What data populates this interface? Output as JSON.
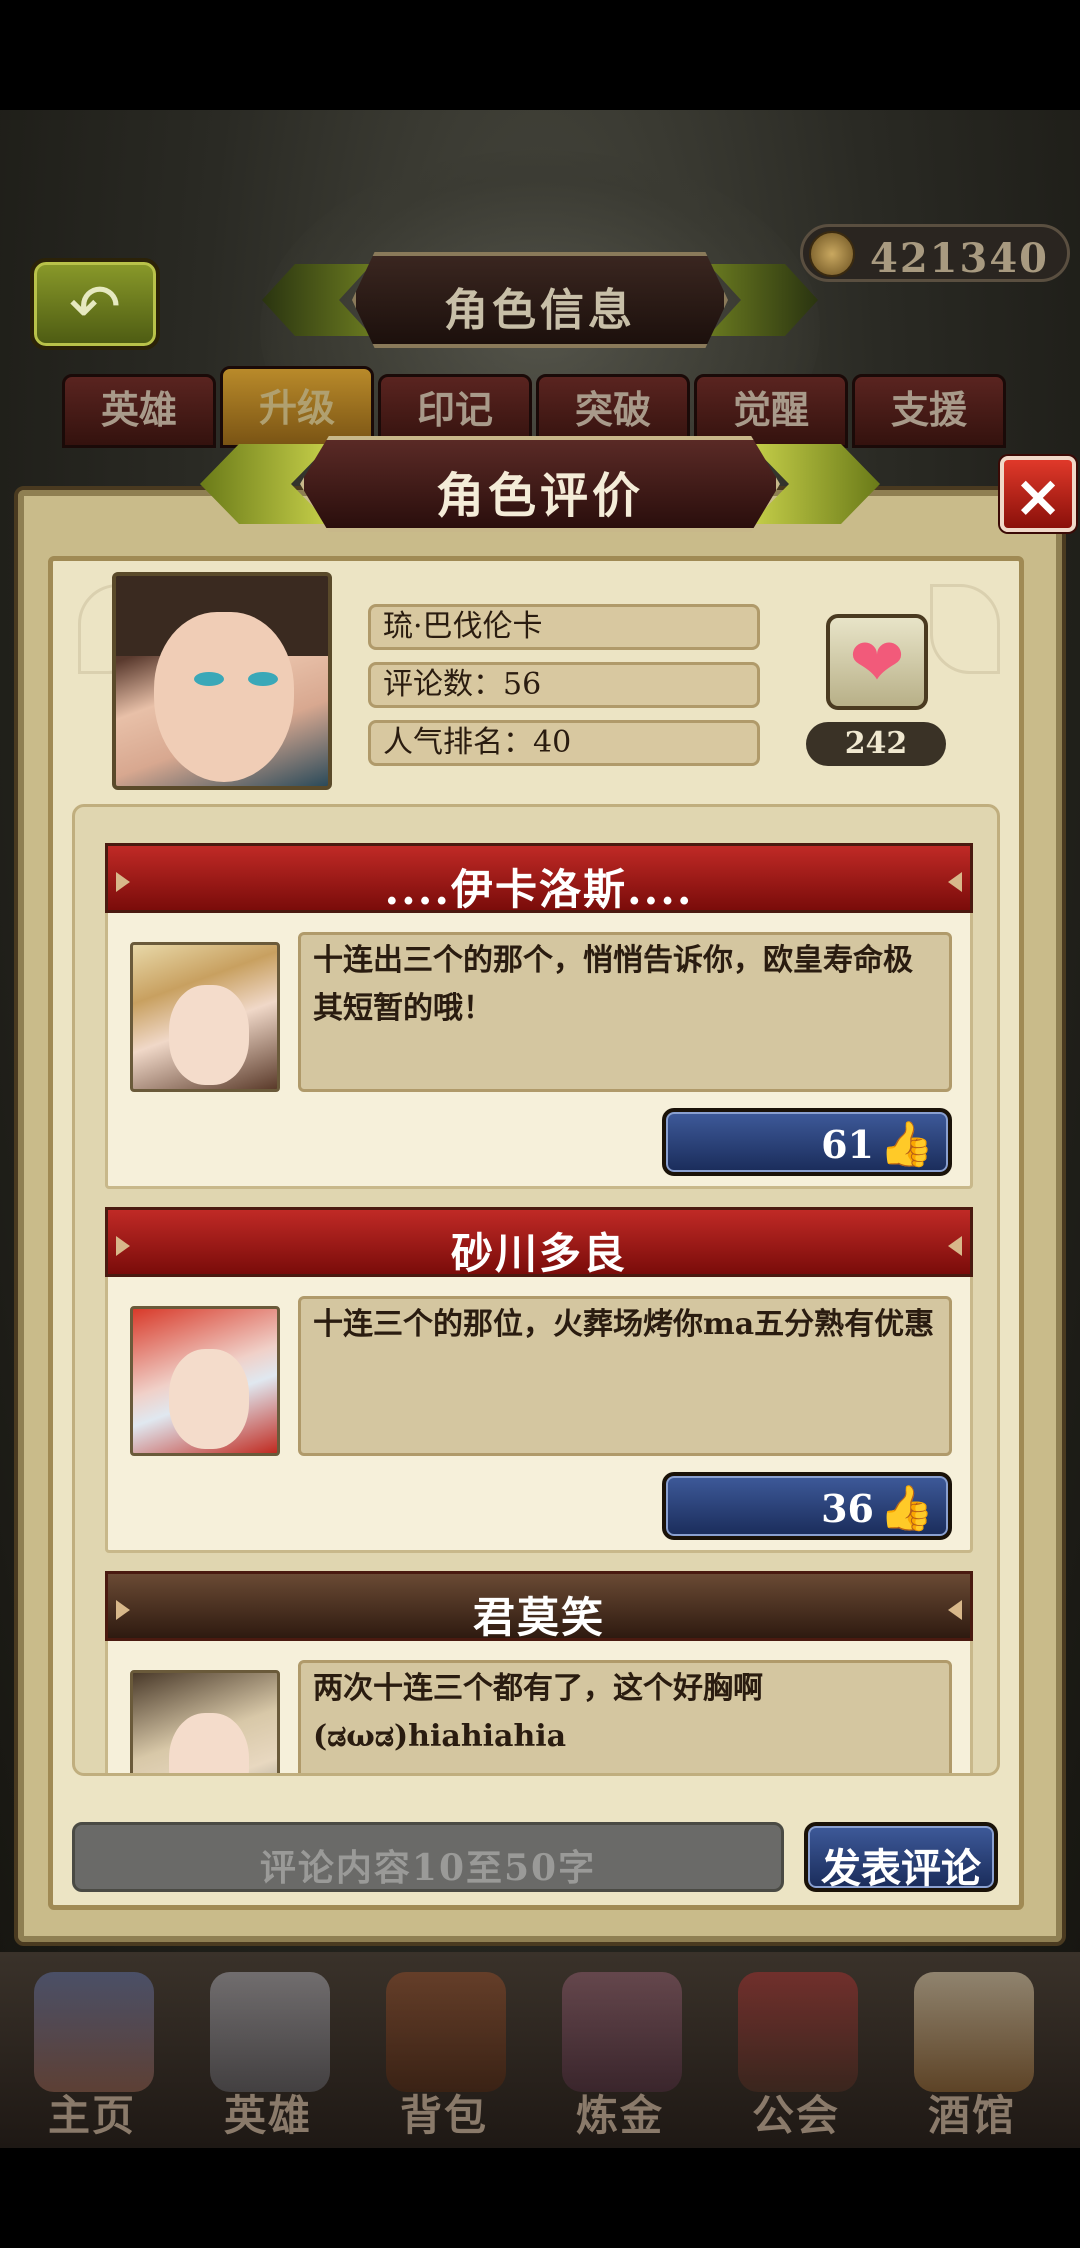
{
  "top": {
    "title": "角色信息",
    "currency": "421340",
    "tabs": [
      {
        "label": "英雄",
        "active": false
      },
      {
        "label": "升级",
        "active": true
      },
      {
        "label": "印记",
        "active": false
      },
      {
        "label": "突破",
        "active": false
      },
      {
        "label": "觉醒",
        "active": false
      },
      {
        "label": "支援",
        "active": false
      }
    ]
  },
  "dialog": {
    "title": "角色评价",
    "close_icon": "×",
    "character": {
      "name": "琉·巴伐伦卡",
      "comments": "评论数：56",
      "ranking": "人气排名：40",
      "heart_icon": "❤",
      "likes": "242"
    },
    "comments": [
      {
        "user": "....伊卡洛斯....",
        "text": "十连出三个的那个，悄悄告诉你，欧皇寿命极其短暂的哦！",
        "likes": "61",
        "header_color": "#b02420"
      },
      {
        "user": "砂川多良",
        "text": "十连三个的那位，火葬场烤你ma五分熟有优惠",
        "likes": "36",
        "header_color": "#b02420"
      },
      {
        "user": "君莫笑",
        "text": "两次十连三个都有了，这个好胸啊(ಡωಡ)hiahiahia",
        "likes": "",
        "header_color": "#5a3a26"
      }
    ],
    "input_placeholder": "评论内容10至50字",
    "post_label": "发表评论"
  },
  "bottom_nav": [
    {
      "label": "主页",
      "icon": "castle-icon"
    },
    {
      "label": "英雄",
      "icon": "helmet-icon"
    },
    {
      "label": "背包",
      "icon": "bag-icon"
    },
    {
      "label": "炼金",
      "icon": "flask-icon"
    },
    {
      "label": "公会",
      "icon": "shield-icon"
    },
    {
      "label": "酒馆",
      "icon": "beer-icon"
    }
  ]
}
